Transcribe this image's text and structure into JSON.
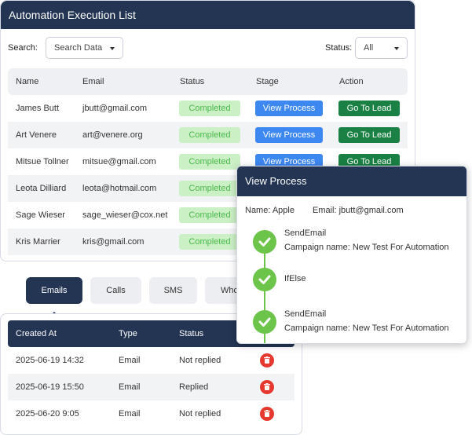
{
  "main": {
    "title": "Automation Execution List",
    "search_label": "Search:",
    "search_select": "Search Data",
    "status_label": "Status:",
    "status_select": "All",
    "columns": [
      "Name",
      "Email",
      "Status",
      "Stage",
      "Action"
    ],
    "view_label": "View Process",
    "lead_label": "Go To Lead",
    "rows": [
      {
        "name": "James Butt",
        "email": "jbutt@gmail.com",
        "status": "Completed"
      },
      {
        "name": "Art Venere",
        "email": "art@venere.org",
        "status": "Completed"
      },
      {
        "name": "Mitsue Tollner",
        "email": "mitsue@gmail.com",
        "status": "Completed"
      },
      {
        "name": "Leota Dilliard",
        "email": "leota@hotmail.com",
        "status": "Completed"
      },
      {
        "name": "Sage Wieser",
        "email": "sage_wieser@cox.net",
        "status": "Completed"
      },
      {
        "name": "Kris Marrier",
        "email": "kris@gmail.com",
        "status": "Completed"
      }
    ]
  },
  "tabs": [
    "Emails",
    "Calls",
    "SMS",
    "Whc"
  ],
  "emails": {
    "columns": [
      "Created At",
      "Type",
      "Status"
    ],
    "rows": [
      {
        "created": "2025-06-19 14:32",
        "type": "Email",
        "status": "Not replied"
      },
      {
        "created": "2025-06-19 15:50",
        "type": "Email",
        "status": "Replied"
      },
      {
        "created": "2025-06-20 9:05",
        "type": "Email",
        "status": "Not replied"
      }
    ]
  },
  "modal": {
    "title": "View Process",
    "name_line": "Name: Apple",
    "email_line": "Email: jbutt@gmail.com",
    "steps": [
      {
        "title": "SendEmail",
        "detail": "Campaign name: New Test For Automation"
      },
      {
        "title": "IfElse",
        "detail": ""
      },
      {
        "title": "SendEmail",
        "detail": "Campaign name: New Test For Automation"
      }
    ]
  },
  "colors": {
    "header": "#233553",
    "completed_bg": "#ccf0c6",
    "view_button": "#3d87f0",
    "lead_button": "#1a8043",
    "success": "#6cc54a",
    "delete": "#e5392f"
  },
  "icons": [
    "chevron-down-icon",
    "trash-icon",
    "check-circle-icon"
  ]
}
